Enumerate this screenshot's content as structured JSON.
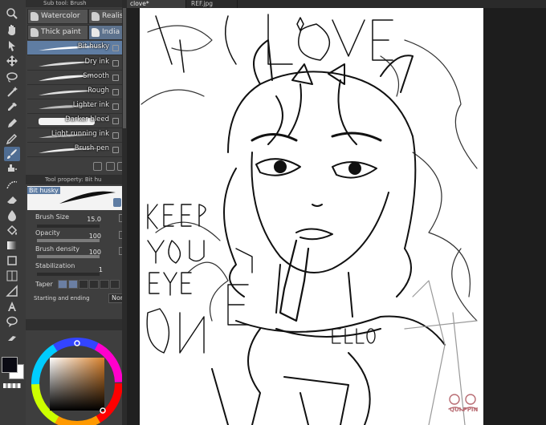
{
  "subtool": {
    "header": "Sub tool: Brush",
    "groups": [
      "Watercolor",
      "Realistic w",
      "Thick paint",
      "India ink"
    ],
    "brushes": [
      "Bit husky",
      "Dry ink",
      "Smooth",
      "Rough",
      "Lighter ink",
      "Darker bleed",
      "Light running ink",
      "Brush pen"
    ]
  },
  "tool_property": {
    "header": "Tool property: Bit hu",
    "preview_label": "Bit husky",
    "brush_size_label": "Brush Size",
    "brush_size_value": "15.0",
    "opacity_label": "Opacity",
    "opacity_value": "100",
    "brush_density_label": "Brush density",
    "brush_density_value": "100",
    "stabilization_label": "Stabilization",
    "stabilization_value": "1",
    "taper_label": "Taper",
    "start_end_label": "Starting and ending",
    "start_end_value": "None"
  },
  "tabs": [
    "clove*",
    "REF.jpg"
  ],
  "canvas": {
    "lettering_top": "LOVE",
    "lettering_left": "KEEP YOUR EYES",
    "lettering_left2": "ON ME",
    "collar_text": "ELLO",
    "signature": "QUI PPIN"
  },
  "colors": {
    "main_color": "#0b0b14",
    "sub_color": "#ffffff",
    "accent": "#5f7da3",
    "picker_square_top": "#d8812c"
  }
}
